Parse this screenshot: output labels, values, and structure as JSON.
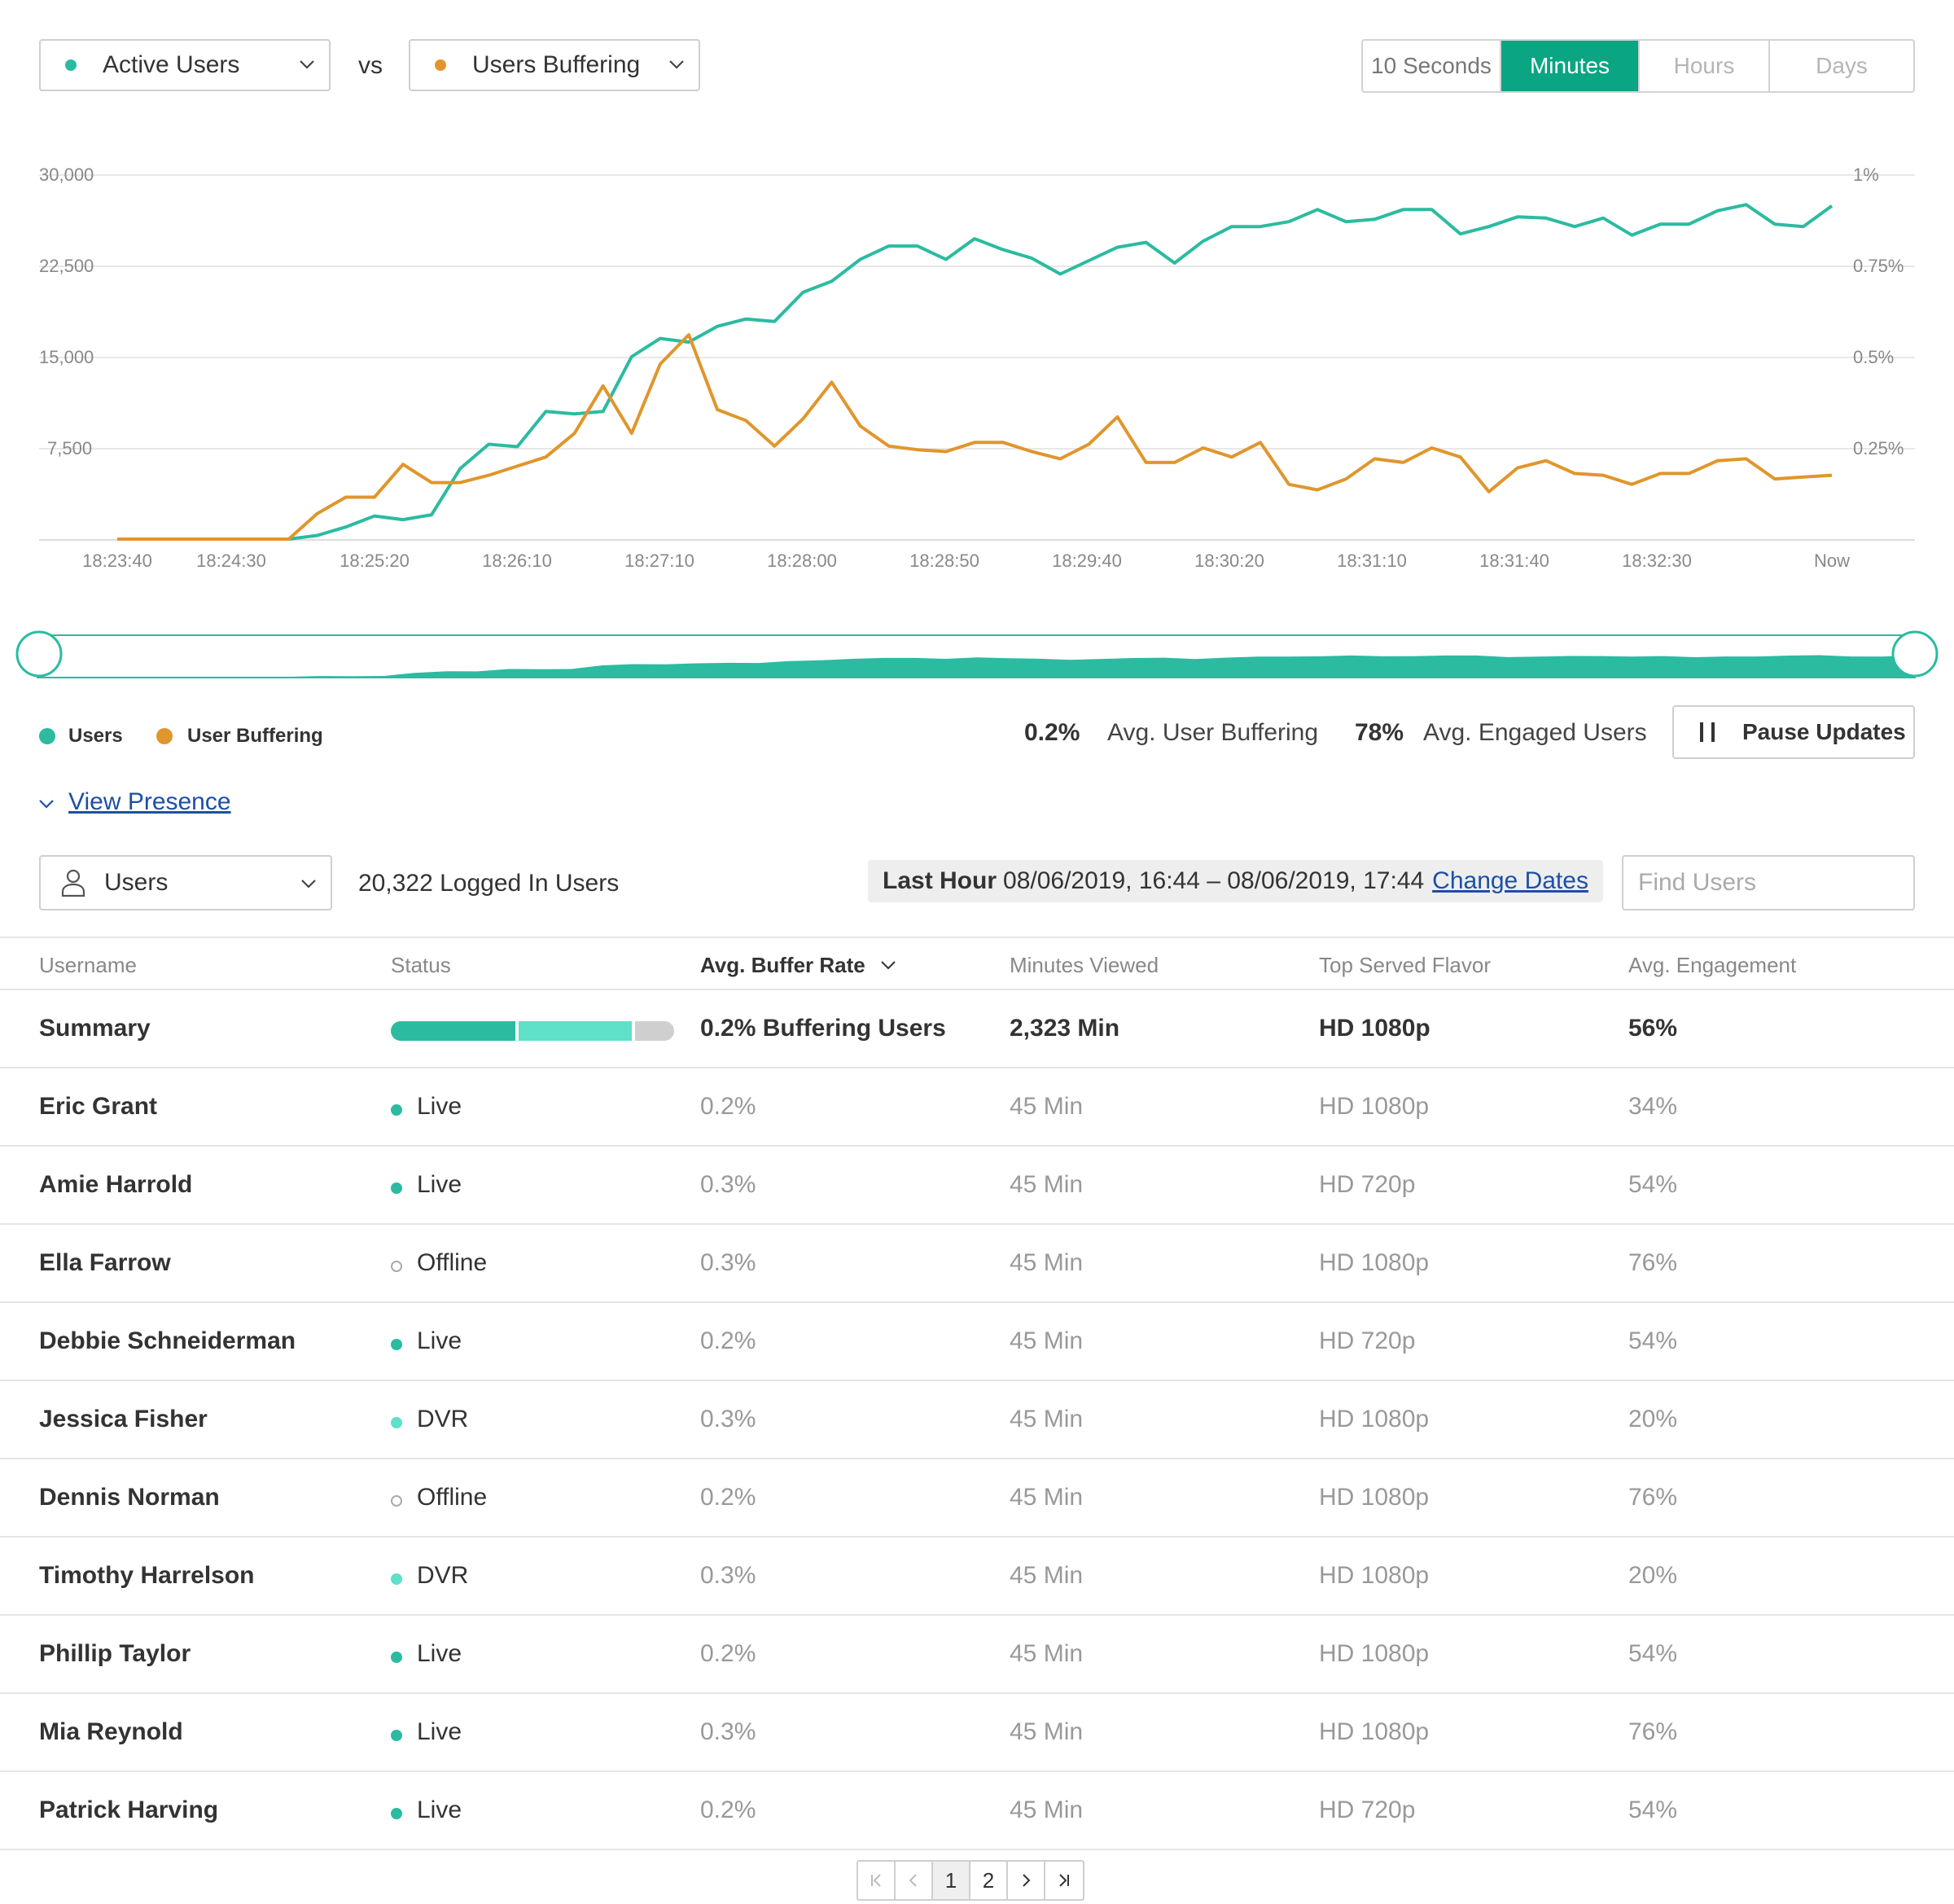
{
  "colors": {
    "active_users": "#2bbba0",
    "buffering": "#e0962c",
    "accent": "#0aa583"
  },
  "metric_left": {
    "label": "Active Users"
  },
  "vs_label": "vs",
  "metric_right": {
    "label": "Users Buffering"
  },
  "time_range": {
    "options": [
      "10 Seconds",
      "Minutes",
      "Hours",
      "Days"
    ],
    "selected": "Minutes"
  },
  "chart_data": {
    "type": "line",
    "x": [
      "18:23:40",
      "18:24:30",
      "18:25:20",
      "18:26:10",
      "18:27:10",
      "18:28:00",
      "18:28:50",
      "18:29:40",
      "18:30:20",
      "18:31:10",
      "18:31:40",
      "18:32:30",
      "Now"
    ],
    "y_left_ticks": [
      "30,000",
      "22,500",
      "15,000",
      "7,500"
    ],
    "y_right_ticks": [
      "1%",
      "0.75%",
      "0.5%",
      "0.25%"
    ],
    "y_left_range": [
      0,
      30000
    ],
    "y_right_range": [
      0,
      1
    ],
    "grid": true,
    "series": [
      {
        "name": "Users",
        "axis": "left",
        "values": [
          0,
          0,
          0,
          0,
          0,
          0,
          0,
          300,
          1000,
          1900,
          1600,
          2000,
          5800,
          7800,
          7600,
          10500,
          10300,
          10500,
          15000,
          16500,
          16200,
          17500,
          18100,
          17900,
          20300,
          21200,
          23000,
          24100,
          24100,
          23000,
          24700,
          23800,
          23100,
          21800,
          22900,
          24000,
          24400,
          22700,
          24500,
          25700,
          25700,
          26100,
          27100,
          26100,
          26300,
          27100,
          27100,
          25100,
          25700,
          26500,
          26400,
          25700,
          26400,
          25000,
          25900,
          25900,
          27000,
          27500,
          25900,
          25700,
          27400
        ]
      },
      {
        "name": "User Buffering",
        "axis": "right",
        "values": [
          0,
          0,
          0,
          0,
          0,
          0,
          0,
          0.07,
          0.115,
          0.115,
          0.205,
          0.155,
          0.155,
          0.175,
          0.2,
          0.225,
          0.29,
          0.42,
          0.29,
          0.48,
          0.56,
          0.355,
          0.325,
          0.255,
          0.33,
          0.43,
          0.31,
          0.255,
          0.245,
          0.24,
          0.265,
          0.265,
          0.24,
          0.22,
          0.26,
          0.335,
          0.21,
          0.21,
          0.25,
          0.225,
          0.265,
          0.15,
          0.135,
          0.165,
          0.22,
          0.21,
          0.25,
          0.225,
          0.13,
          0.195,
          0.215,
          0.18,
          0.175,
          0.15,
          0.18,
          0.18,
          0.215,
          0.22,
          0.165,
          0.17,
          0.175
        ]
      }
    ]
  },
  "legend": {
    "users": "Users",
    "buffering": "User Buffering"
  },
  "stats": {
    "buffering_value": "0.2%",
    "buffering_label": "Avg. User Buffering",
    "engaged_value": "78%",
    "engaged_label": "Avg. Engaged Users"
  },
  "pause_button": "Pause Updates",
  "view_presence": "View Presence",
  "users_filter": {
    "label": "Users"
  },
  "logged_in": "20,322 Logged In Users",
  "date_range": {
    "bold": "Last Hour",
    "range": "08/06/2019, 16:44 – 08/06/2019, 17:44",
    "change": "Change Dates"
  },
  "search": {
    "placeholder": "Find Users"
  },
  "table": {
    "headers": [
      "Username",
      "Status",
      "Avg. Buffer Rate",
      "Minutes Viewed",
      "Top Served Flavor",
      "Avg. Engagement"
    ],
    "summary": {
      "name": "Summary",
      "buffer": "0.2% Buffering Users",
      "minutes": "2,323 Min",
      "flavor": "HD 1080p",
      "engagement": "56%",
      "status_bar": [
        0.45,
        0.41,
        0.14
      ]
    },
    "rows": [
      {
        "name": "Eric Grant",
        "status": "Live",
        "buffer": "0.2%",
        "minutes": "45 Min",
        "flavor": "HD 1080p",
        "engagement": "34%"
      },
      {
        "name": "Amie Harrold",
        "status": "Live",
        "buffer": "0.3%",
        "minutes": "45 Min",
        "flavor": "HD 720p",
        "engagement": "54%"
      },
      {
        "name": "Ella Farrow",
        "status": "Offline",
        "buffer": "0.3%",
        "minutes": "45 Min",
        "flavor": "HD 1080p",
        "engagement": "76%"
      },
      {
        "name": "Debbie Schneiderman",
        "status": "Live",
        "buffer": "0.2%",
        "minutes": "45 Min",
        "flavor": "HD 720p",
        "engagement": "54%"
      },
      {
        "name": "Jessica Fisher",
        "status": "DVR",
        "buffer": "0.3%",
        "minutes": "45 Min",
        "flavor": "HD 1080p",
        "engagement": "20%"
      },
      {
        "name": "Dennis Norman",
        "status": "Offline",
        "buffer": "0.2%",
        "minutes": "45 Min",
        "flavor": "HD 1080p",
        "engagement": "76%"
      },
      {
        "name": "Timothy Harrelson",
        "status": "DVR",
        "buffer": "0.3%",
        "minutes": "45 Min",
        "flavor": "HD 1080p",
        "engagement": "20%"
      },
      {
        "name": "Phillip Taylor",
        "status": "Live",
        "buffer": "0.2%",
        "minutes": "45 Min",
        "flavor": "HD 1080p",
        "engagement": "54%"
      },
      {
        "name": "Mia Reynold",
        "status": "Live",
        "buffer": "0.3%",
        "minutes": "45 Min",
        "flavor": "HD 1080p",
        "engagement": "76%"
      },
      {
        "name": "Patrick Harving",
        "status": "Live",
        "buffer": "0.2%",
        "minutes": "45 Min",
        "flavor": "HD 720p",
        "engagement": "54%"
      }
    ]
  },
  "pagination": {
    "pages": [
      "1",
      "2"
    ],
    "current": "1"
  }
}
